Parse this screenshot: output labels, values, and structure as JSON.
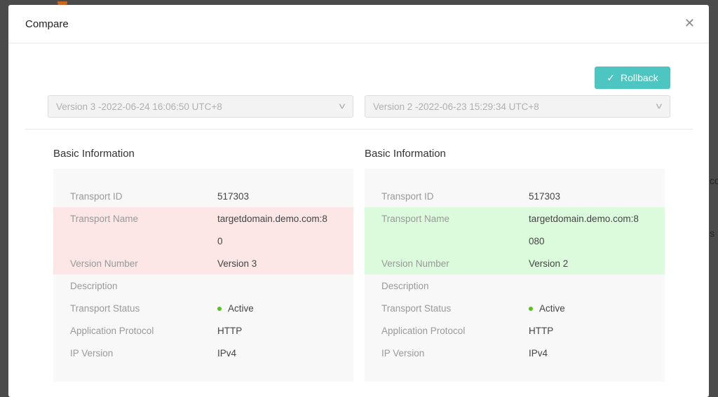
{
  "background": {
    "text1": "co",
    "text2": "s"
  },
  "modal": {
    "title": "Compare",
    "close_icon": "close-icon",
    "rollback_label": "Rollback",
    "left_select": "Version 3 -2022-06-24 16:06:50 UTC+8",
    "right_select": "Version 2 -2022-06-23 15:29:34 UTC+8"
  },
  "left": {
    "title": "Basic Information",
    "rows": [
      {
        "label": "Transport ID",
        "value": "517303"
      },
      {
        "label": "Transport Name",
        "value": "targetdomain.demo.com:8"
      },
      {
        "label": "",
        "value": "0"
      },
      {
        "label": "Version Number",
        "value": "Version 3"
      },
      {
        "label": "Description",
        "value": ""
      },
      {
        "label": "Transport Status",
        "value": "Active"
      },
      {
        "label": "Application Protocol",
        "value": "HTTP"
      },
      {
        "label": "IP Version",
        "value": "IPv4"
      }
    ]
  },
  "right": {
    "title": "Basic Information",
    "rows": [
      {
        "label": "Transport ID",
        "value": "517303"
      },
      {
        "label": "Transport Name",
        "value": "targetdomain.demo.com:8"
      },
      {
        "label": "",
        "value": "080"
      },
      {
        "label": "Version Number",
        "value": "Version 2"
      },
      {
        "label": "Description",
        "value": ""
      },
      {
        "label": "Transport Status",
        "value": "Active"
      },
      {
        "label": "Application Protocol",
        "value": "HTTP"
      },
      {
        "label": "IP Version",
        "value": "IPv4"
      }
    ]
  },
  "colors": {
    "accent": "#4dc6c1",
    "removed": "#fde6e6",
    "added": "#dcfbdc",
    "active": "#52c41a"
  }
}
